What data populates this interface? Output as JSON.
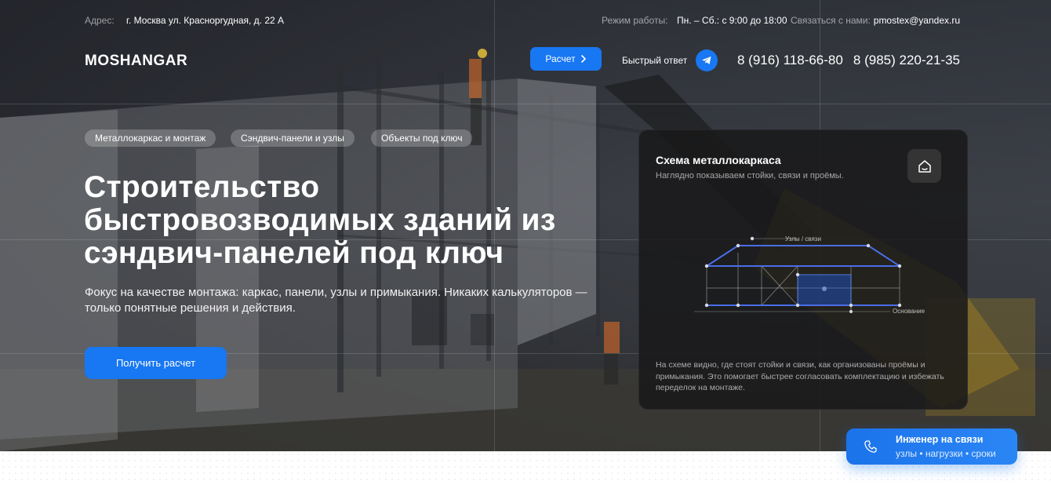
{
  "topbar": {
    "address_label": "Адрес:",
    "address_value": "г. Москва ул. Красноprудная, д. 22 А",
    "hours_label": "Режим работы:",
    "hours_value": "Пн. – Сб.: с 9:00 до 18:00",
    "contact_label": "Связаться с нами:",
    "email": "pmostex@yandex.ru"
  },
  "header": {
    "logo": "MOSHANGAR",
    "calc_button": "Расчет",
    "quick_answer": "Быстрый ответ",
    "phone1": "8 (916) 118-66-80",
    "phone2": "8 (985) 220-21-35"
  },
  "hero": {
    "chips": [
      "Металлокаркас и монтаж",
      "Сэндвич-панели и узлы",
      "Объекты под ключ"
    ],
    "headline": "Строительство быстровозводимых зданий из сэндвич-панелей под ключ",
    "lead": "Фокус на качестве монтажа: каркас, панели, узлы и примыкания. Никаких калькуляторов — только понятные решения и действия.",
    "cta": "Получить расчет"
  },
  "scheme": {
    "title": "Схема металлокаркаса",
    "subtitle": "Наглядно показываем стойки, связи и проёмы.",
    "label_nodes": "Узлы / связи",
    "label_base": "Основание",
    "description": "На схеме видно, где стоят стойки и связи, как организованы проёмы и примыкания. Это помогает быстрее согласовать комплектацию и избежать переделок на монтаже."
  },
  "engineer": {
    "title": "Инженер на связи",
    "subtitle": "узлы • нагрузки • сроки"
  },
  "colors": {
    "accent": "#1877f2"
  }
}
